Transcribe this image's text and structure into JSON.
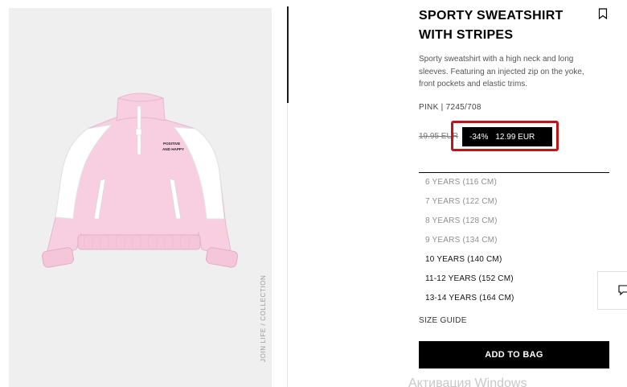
{
  "product": {
    "title": "SPORTY SWEATSHIRT WITH STRIPES",
    "description": "Sporty sweatshirt with a high neck and long sleeves. Featuring an injected zip on the yoke, front pockets and elastic trims.",
    "color_code": "PINK | 7245/708",
    "old_price": "19.95 EUR",
    "discount": "-34%",
    "sale_price": "12.99 EUR",
    "print_text_line1": "POSITIVE",
    "print_text_line2": "AND HAPPY",
    "collection_label": "JOIN LIFE / COLLECTION"
  },
  "sizes": [
    {
      "label": "6 YEARS (116 CM)",
      "available": false
    },
    {
      "label": "7 YEARS (122 CM)",
      "available": false
    },
    {
      "label": "8 YEARS (128 CM)",
      "available": false
    },
    {
      "label": "9 YEARS (134 CM)",
      "available": false
    },
    {
      "label": "10 YEARS (140 CM)",
      "available": true
    },
    {
      "label": "11-12 YEARS (152 CM)",
      "available": true
    },
    {
      "label": "13-14 YEARS (164 CM)",
      "available": true
    }
  ],
  "actions": {
    "size_guide": "SIZE GUIDE",
    "add_to_bag": "ADD TO BAG"
  },
  "icons": {
    "bookmark": "bookmark-icon",
    "chat": "chat-icon"
  },
  "colors": {
    "highlight": "#c0141b",
    "sweatshirt_pink": "#f7cfe0",
    "sweatshirt_white": "#ffffff"
  },
  "overlay": {
    "watermark": "Активация Windows"
  }
}
